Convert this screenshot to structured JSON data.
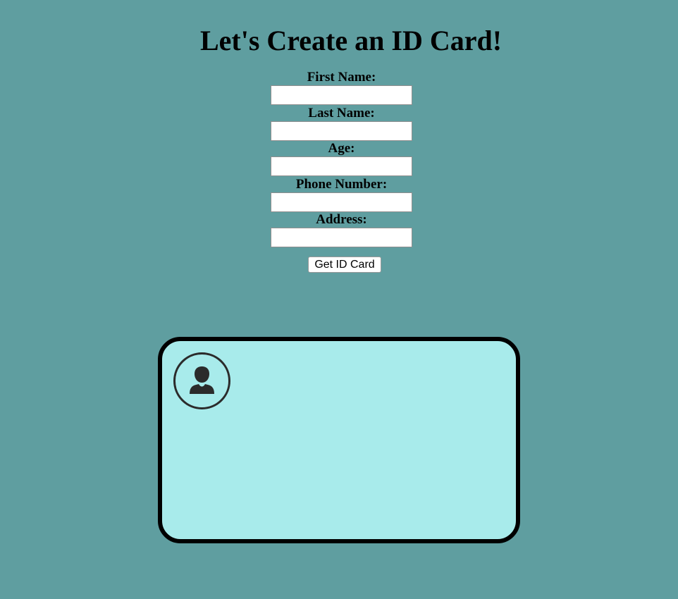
{
  "page": {
    "title": "Let's Create an ID Card!"
  },
  "form": {
    "fields": [
      {
        "label": "First Name:",
        "value": ""
      },
      {
        "label": "Last Name:",
        "value": ""
      },
      {
        "label": "Age:",
        "value": ""
      },
      {
        "label": "Phone Number:",
        "value": ""
      },
      {
        "label": "Address:",
        "value": ""
      }
    ],
    "submit_label": "Get ID Card"
  },
  "card": {
    "avatar_icon": "user-icon"
  },
  "colors": {
    "page_background": "#5f9ea0",
    "card_background": "#a8ebeb",
    "card_border": "#000000",
    "avatar_color": "#2b2b2b"
  }
}
